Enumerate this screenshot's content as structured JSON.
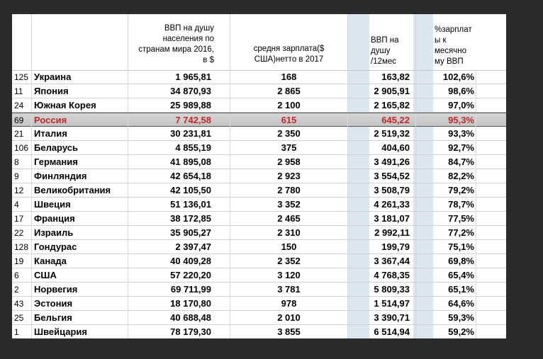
{
  "headers": {
    "gdp": "ВВП на душу\nнаселения по\nстранам мира 2016,\nв $",
    "salary": "средня зарплата($\nСША)нетто в 2017",
    "monthly": "ВВП на\nдушу\n/12мес",
    "pct": "%зарплат\nы к\nмесячно\nму ВВП"
  },
  "colors": {
    "highlight_text": "#c0282e",
    "highlight_band": "#c8c8c8",
    "column_tint": "#dce6f1"
  },
  "rows": [
    {
      "rank": "125",
      "country": "Украина",
      "gdp": "1 965,81",
      "salary": "168",
      "monthly": "163,82",
      "pct": "102,6%"
    },
    {
      "rank": "11",
      "country": "Япония",
      "gdp": "34 870,93",
      "salary": "2 865",
      "monthly": "2 905,91",
      "pct": "98,6%"
    },
    {
      "rank": "24",
      "country": "Южная Корея",
      "gdp": "25 989,88",
      "salary": "2 100",
      "monthly": "2 165,82",
      "pct": "97,0%"
    },
    {
      "rank": "69",
      "country": "Россия",
      "gdp": "7 742,58",
      "salary": "615",
      "monthly": "645,22",
      "pct": "95,3%",
      "highlight": true
    },
    {
      "rank": "21",
      "country": "Италия",
      "gdp": "30 231,81",
      "salary": "2 350",
      "monthly": "2 519,32",
      "pct": "93,3%"
    },
    {
      "rank": "106",
      "country": "Беларусь",
      "gdp": "4 855,19",
      "salary": "375",
      "monthly": "404,60",
      "pct": "92,7%"
    },
    {
      "rank": "8",
      "country": "Германия",
      "gdp": "41 895,08",
      "salary": "2 958",
      "monthly": "3 491,26",
      "pct": "84,7%"
    },
    {
      "rank": "9",
      "country": "Финляндия",
      "gdp": "42 654,18",
      "salary": "2 923",
      "monthly": "3 554,52",
      "pct": "82,2%"
    },
    {
      "rank": "12",
      "country": "Великобритания",
      "gdp": "42 105,50",
      "salary": "2 780",
      "monthly": "3 508,79",
      "pct": "79,2%"
    },
    {
      "rank": "4",
      "country": "Швеция",
      "gdp": "51 136,01",
      "salary": "3 352",
      "monthly": "4 261,33",
      "pct": "78,7%"
    },
    {
      "rank": "17",
      "country": "Франция",
      "gdp": "38 172,85",
      "salary": "2 465",
      "monthly": "3 181,07",
      "pct": "77,5%"
    },
    {
      "rank": "22",
      "country": "Израиль",
      "gdp": "35 905,27",
      "salary": "2 310",
      "monthly": "2 992,11",
      "pct": "77,2%"
    },
    {
      "rank": "128",
      "country": "Гондурас",
      "gdp": "2 397,47",
      "salary": "150",
      "monthly": "199,79",
      "pct": "75,1%"
    },
    {
      "rank": "19",
      "country": "Канада",
      "gdp": "40 409,28",
      "salary": "2 352",
      "monthly": "3 367,44",
      "pct": "69,8%"
    },
    {
      "rank": "6",
      "country": "США",
      "gdp": "57 220,20",
      "salary": "3 120",
      "monthly": "4 768,35",
      "pct": "65,4%"
    },
    {
      "rank": "2",
      "country": "Норвегия",
      "gdp": "69 711,99",
      "salary": "3 781",
      "monthly": "5 809,33",
      "pct": "65,1%"
    },
    {
      "rank": "43",
      "country": "Эстония",
      "gdp": "18 170,80",
      "salary": "978",
      "monthly": "1 514,97",
      "pct": "64,6%"
    },
    {
      "rank": "25",
      "country": "Бельгия",
      "gdp": "40 688,48",
      "salary": "2 010",
      "monthly": "3 390,71",
      "pct": "59,3%"
    },
    {
      "rank": "1",
      "country": "Швейцария",
      "gdp": "78 179,30",
      "salary": "3 855",
      "monthly": "6 514,94",
      "pct": "59,2%"
    }
  ]
}
